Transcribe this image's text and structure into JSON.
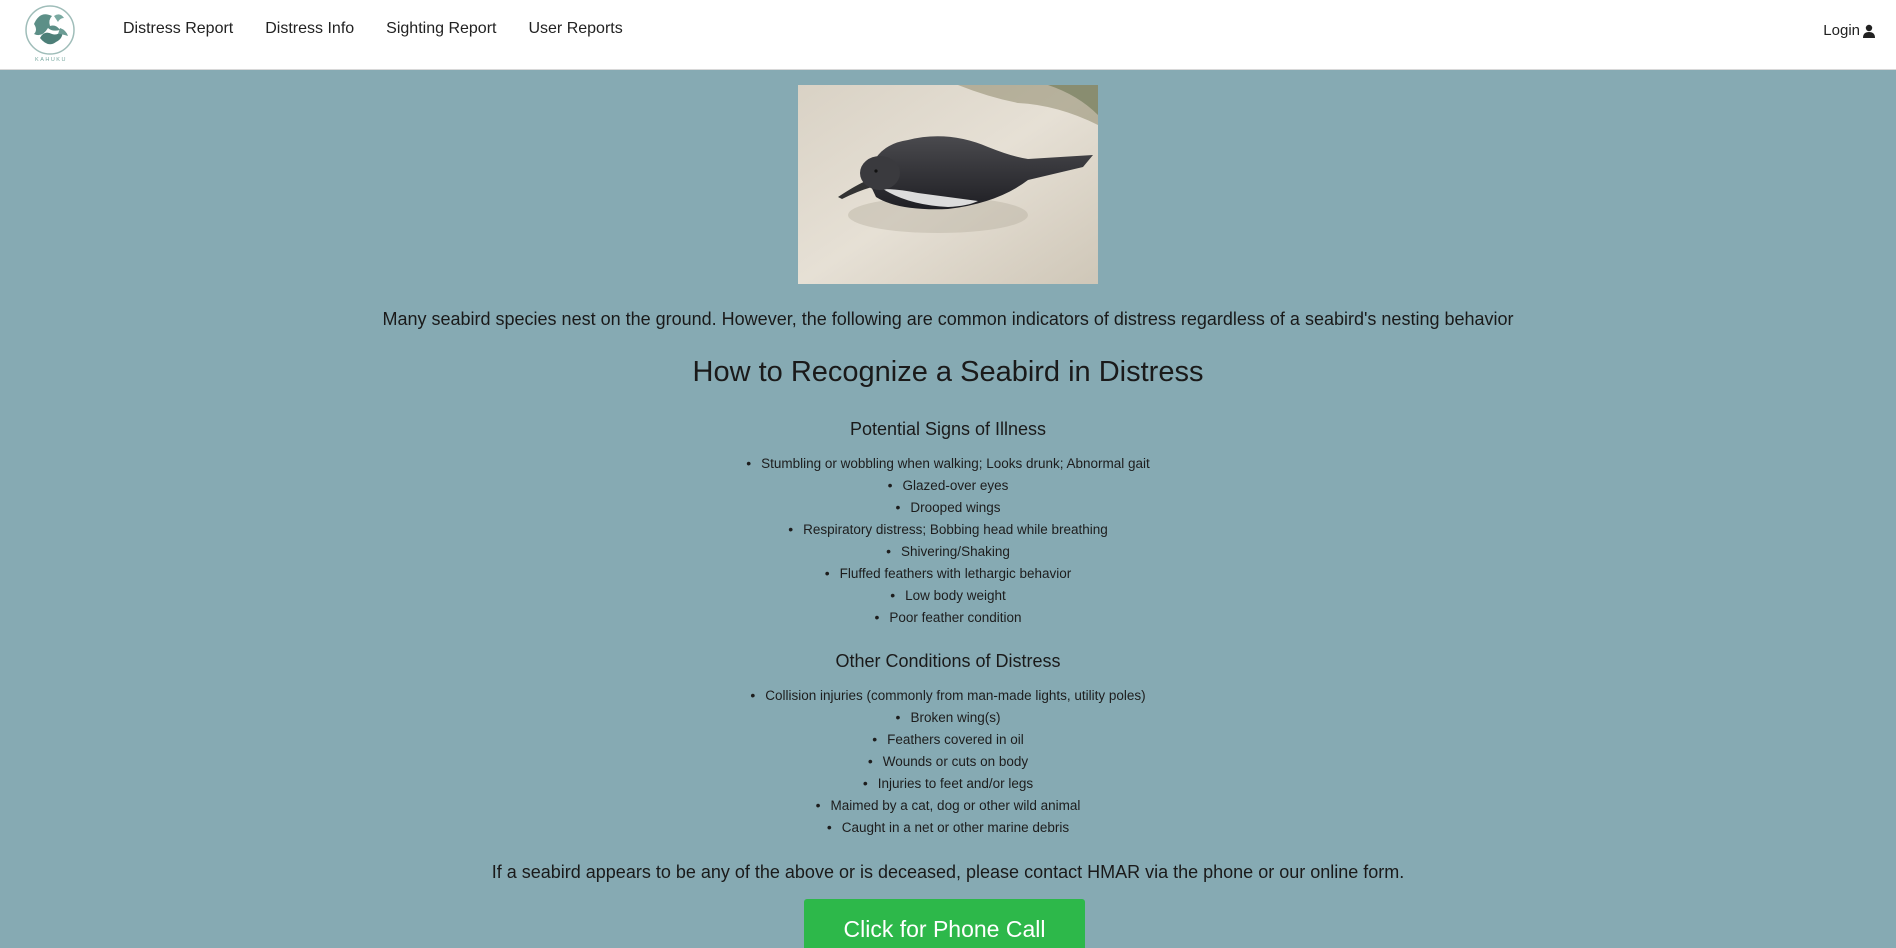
{
  "nav": {
    "links": [
      "Distress Report",
      "Distress Info",
      "Sighting Report",
      "User Reports"
    ],
    "login_label": "Login",
    "login_icon": "user-icon",
    "logo_text": "KAHUKU"
  },
  "hero": {
    "image": "seabird-on-sand"
  },
  "content": {
    "intro": "Many seabird species nest on the ground. However, the following are common indicators of distress regardless of a seabird's nesting behavior",
    "title": "How to Recognize a Seabird in Distress",
    "illness_heading": "Potential Signs of Illness",
    "illness_signs": [
      "Stumbling or wobbling when walking; Looks drunk; Abnormal gait",
      "Glazed-over eyes",
      "Drooped wings",
      "Respiratory distress; Bobbing head while breathing",
      "Shivering/Shaking",
      "Fluffed feathers with lethargic behavior",
      "Low body weight",
      "Poor feather condition"
    ],
    "other_heading": "Other Conditions of Distress",
    "other_conditions": [
      "Collision injuries (commonly from man-made lights, utility poles)",
      "Broken wing(s)",
      "Feathers covered in oil",
      "Wounds or cuts on body",
      "Injuries to feet and/or legs",
      "Maimed by a cat, dog or other wild animal",
      "Caught in a net or other marine debris"
    ],
    "contact": "If a seabird appears to be any of the above or is deceased, please contact HMAR via the phone or our online form.",
    "phone_button": "Click for Phone Call"
  },
  "colors": {
    "page_background": "#86aab3",
    "navbar_background": "#ffffff",
    "button_green": "#2db84a"
  }
}
